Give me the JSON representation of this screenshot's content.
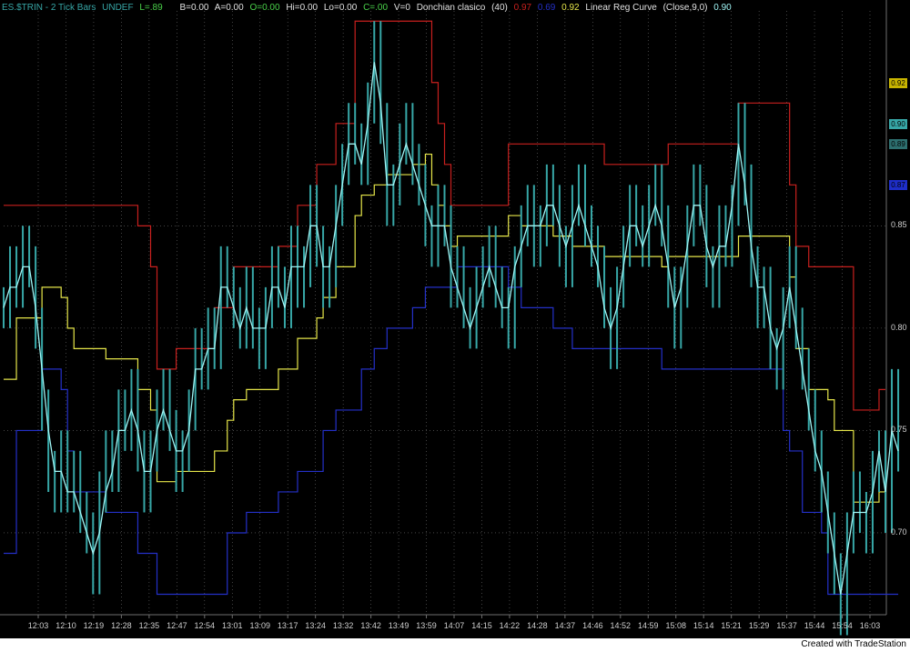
{
  "header": {
    "symbol": "ES.$TRIN - 2 Tick Bars",
    "undef": "UNDEF",
    "last": "L=.89",
    "bid": "B=0.00",
    "ask": "A=0.00",
    "open": "O=0.00",
    "high": "Hi=0.00",
    "low": "Lo=0.00",
    "close": "C=.00",
    "volume": "V=0",
    "study1_name": "Donchian clasico",
    "study1_param": "(40)",
    "study1_upper": "0.97",
    "study1_lower": "0.69",
    "study1_mid": "0.92",
    "study2_name": "Linear Reg Curve",
    "study2_param": "(Close,9,0)",
    "study2_value": "0.90"
  },
  "colors": {
    "background": "#000000",
    "donchian_upper": "#c8201e",
    "donchian_lower": "#2430c8",
    "donchian_mid": "#e6e64a",
    "price_bars": "#37a7a7",
    "lin_reg": "#9ff5f5",
    "grid": "#6e6e6e",
    "axis_text": "#cfcfcf"
  },
  "price_tags": [
    {
      "value": 0.92,
      "label": "0.92",
      "color": "#c8b400"
    },
    {
      "value": 0.9,
      "label": "0.90",
      "color": "#37a7a7"
    },
    {
      "value": 0.89,
      "label": "0.89",
      "color": "#2d6f6f"
    },
    {
      "value": 0.87,
      "label": "0.87",
      "color": "#1e2ec8"
    }
  ],
  "credit": "Created with TradeStation",
  "chart_data": {
    "type": "line",
    "ylim": [
      0.66,
      0.955
    ],
    "yticks": [
      "0.70",
      "0.75",
      "0.80",
      "0.85"
    ],
    "xtick_labels": [
      "12:03",
      "12:10",
      "12:19",
      "12:28",
      "12:35",
      "12:47",
      "12:54",
      "13:01",
      "13:09",
      "13:17",
      "13:24",
      "13:32",
      "13:42",
      "13:49",
      "13:59",
      "14:07",
      "14:15",
      "14:22",
      "14:28",
      "14:37",
      "14:46",
      "14:52",
      "14:59",
      "15:08",
      "15:14",
      "15:21",
      "15:29",
      "15:37",
      "15:44",
      "15:54",
      "16:03"
    ],
    "grid": true,
    "series": [
      {
        "name": "Donchian upper",
        "kind": "step",
        "values": [
          0.86,
          0.86,
          0.86,
          0.86,
          0.86,
          0.86,
          0.86,
          0.86,
          0.86,
          0.86,
          0.86,
          0.86,
          0.86,
          0.86,
          0.86,
          0.86,
          0.86,
          0.86,
          0.86,
          0.86,
          0.86,
          0.85,
          0.85,
          0.83,
          0.78,
          0.78,
          0.78,
          0.79,
          0.79,
          0.79,
          0.79,
          0.79,
          0.79,
          0.81,
          0.81,
          0.81,
          0.83,
          0.83,
          0.83,
          0.83,
          0.83,
          0.83,
          0.83,
          0.84,
          0.84,
          0.84,
          0.86,
          0.86,
          0.86,
          0.88,
          0.88,
          0.88,
          0.9,
          0.9,
          0.9,
          0.95,
          0.95,
          0.95,
          0.95,
          0.95,
          0.95,
          0.95,
          0.95,
          0.95,
          0.95,
          0.95,
          0.95,
          0.92,
          0.9,
          0.88,
          0.86,
          0.86,
          0.86,
          0.86,
          0.86,
          0.86,
          0.86,
          0.86,
          0.86,
          0.89,
          0.89,
          0.89,
          0.89,
          0.89,
          0.89,
          0.89,
          0.89,
          0.89,
          0.89,
          0.89,
          0.89,
          0.89,
          0.89,
          0.89,
          0.88,
          0.88,
          0.88,
          0.88,
          0.88,
          0.88,
          0.88,
          0.88,
          0.88,
          0.88,
          0.89,
          0.89,
          0.89,
          0.89,
          0.89,
          0.89,
          0.89,
          0.89,
          0.89,
          0.89,
          0.89,
          0.91,
          0.91,
          0.91,
          0.91,
          0.91,
          0.91,
          0.91,
          0.91,
          0.87,
          0.84,
          0.84,
          0.83,
          0.83,
          0.83,
          0.83,
          0.83,
          0.83,
          0.83,
          0.76,
          0.76,
          0.76,
          0.76,
          0.77,
          0.77
        ]
      },
      {
        "name": "Donchian lower",
        "kind": "step",
        "values": [
          0.69,
          0.69,
          0.75,
          0.75,
          0.75,
          0.75,
          0.78,
          0.78,
          0.78,
          0.77,
          0.74,
          0.72,
          0.72,
          0.72,
          0.72,
          0.72,
          0.71,
          0.71,
          0.71,
          0.71,
          0.71,
          0.69,
          0.69,
          0.69,
          0.67,
          0.67,
          0.67,
          0.67,
          0.67,
          0.67,
          0.67,
          0.67,
          0.67,
          0.67,
          0.67,
          0.7,
          0.7,
          0.7,
          0.71,
          0.71,
          0.71,
          0.71,
          0.71,
          0.72,
          0.72,
          0.72,
          0.73,
          0.73,
          0.73,
          0.73,
          0.75,
          0.75,
          0.76,
          0.76,
          0.76,
          0.76,
          0.78,
          0.78,
          0.79,
          0.79,
          0.8,
          0.8,
          0.8,
          0.8,
          0.81,
          0.81,
          0.82,
          0.82,
          0.82,
          0.82,
          0.82,
          0.83,
          0.83,
          0.83,
          0.83,
          0.83,
          0.83,
          0.83,
          0.83,
          0.82,
          0.82,
          0.81,
          0.81,
          0.81,
          0.81,
          0.81,
          0.8,
          0.8,
          0.8,
          0.79,
          0.79,
          0.79,
          0.79,
          0.79,
          0.79,
          0.79,
          0.79,
          0.79,
          0.79,
          0.79,
          0.79,
          0.79,
          0.79,
          0.78,
          0.78,
          0.78,
          0.78,
          0.78,
          0.78,
          0.78,
          0.78,
          0.78,
          0.78,
          0.78,
          0.78,
          0.78,
          0.78,
          0.78,
          0.78,
          0.78,
          0.78,
          0.78,
          0.75,
          0.74,
          0.74,
          0.71,
          0.71,
          0.71,
          0.7,
          0.67,
          0.67,
          0.67,
          0.67,
          0.67,
          0.67,
          0.67,
          0.67,
          0.67,
          0.67,
          0.67,
          0.67
        ]
      },
      {
        "name": "Donchian mid",
        "kind": "step",
        "values": [
          0.775,
          0.775,
          0.805,
          0.805,
          0.805,
          0.805,
          0.82,
          0.82,
          0.82,
          0.815,
          0.8,
          0.79,
          0.79,
          0.79,
          0.79,
          0.79,
          0.785,
          0.785,
          0.785,
          0.785,
          0.785,
          0.77,
          0.77,
          0.76,
          0.725,
          0.725,
          0.725,
          0.73,
          0.73,
          0.73,
          0.73,
          0.73,
          0.73,
          0.74,
          0.74,
          0.755,
          0.765,
          0.765,
          0.77,
          0.77,
          0.77,
          0.77,
          0.77,
          0.78,
          0.78,
          0.78,
          0.795,
          0.795,
          0.795,
          0.805,
          0.815,
          0.815,
          0.83,
          0.83,
          0.83,
          0.855,
          0.865,
          0.865,
          0.87,
          0.87,
          0.875,
          0.875,
          0.875,
          0.875,
          0.88,
          0.88,
          0.885,
          0.87,
          0.86,
          0.85,
          0.84,
          0.845,
          0.845,
          0.845,
          0.845,
          0.845,
          0.845,
          0.845,
          0.845,
          0.855,
          0.855,
          0.85,
          0.85,
          0.85,
          0.85,
          0.85,
          0.845,
          0.845,
          0.845,
          0.84,
          0.84,
          0.84,
          0.84,
          0.84,
          0.835,
          0.835,
          0.835,
          0.835,
          0.835,
          0.835,
          0.835,
          0.835,
          0.835,
          0.83,
          0.835,
          0.835,
          0.835,
          0.835,
          0.835,
          0.835,
          0.835,
          0.835,
          0.835,
          0.835,
          0.835,
          0.845,
          0.845,
          0.845,
          0.845,
          0.845,
          0.845,
          0.845,
          0.845,
          0.825,
          0.79,
          0.79,
          0.77,
          0.77,
          0.77,
          0.765,
          0.75,
          0.75,
          0.75,
          0.715,
          0.715,
          0.715,
          0.715,
          0.72,
          0.72
        ]
      },
      {
        "name": "Close",
        "kind": "bars",
        "values": [
          0.81,
          0.83,
          0.82,
          0.84,
          0.83,
          0.8,
          0.76,
          0.73,
          0.72,
          0.74,
          0.72,
          0.73,
          0.71,
          0.7,
          0.68,
          0.72,
          0.74,
          0.73,
          0.76,
          0.75,
          0.77,
          0.74,
          0.72,
          0.74,
          0.76,
          0.77,
          0.75,
          0.73,
          0.74,
          0.76,
          0.79,
          0.78,
          0.8,
          0.79,
          0.83,
          0.82,
          0.81,
          0.8,
          0.82,
          0.8,
          0.79,
          0.81,
          0.83,
          0.82,
          0.81,
          0.84,
          0.82,
          0.83,
          0.86,
          0.84,
          0.82,
          0.83,
          0.86,
          0.88,
          0.9,
          0.89,
          0.88,
          0.91,
          0.94,
          0.9,
          0.86,
          0.87,
          0.89,
          0.9,
          0.88,
          0.87,
          0.85,
          0.84,
          0.86,
          0.85,
          0.82,
          0.83,
          0.81,
          0.8,
          0.82,
          0.83,
          0.84,
          0.82,
          0.81,
          0.8,
          0.83,
          0.85,
          0.86,
          0.84,
          0.85,
          0.87,
          0.86,
          0.84,
          0.83,
          0.86,
          0.87,
          0.85,
          0.84,
          0.83,
          0.81,
          0.79,
          0.82,
          0.84,
          0.86,
          0.85,
          0.84,
          0.86,
          0.87,
          0.85,
          0.82,
          0.8,
          0.82,
          0.85,
          0.87,
          0.86,
          0.83,
          0.82,
          0.85,
          0.84,
          0.86,
          0.9,
          0.87,
          0.83,
          0.81,
          0.82,
          0.79,
          0.78,
          0.81,
          0.83,
          0.8,
          0.78,
          0.76,
          0.74,
          0.72,
          0.7,
          0.68,
          0.66,
          0.7,
          0.72,
          0.71,
          0.7,
          0.73,
          0.74,
          0.71,
          0.77,
          0.74
        ]
      },
      {
        "name": "Linear Reg Curve",
        "kind": "line",
        "values": [
          0.81,
          0.82,
          0.82,
          0.83,
          0.83,
          0.81,
          0.78,
          0.75,
          0.73,
          0.73,
          0.72,
          0.72,
          0.71,
          0.7,
          0.69,
          0.7,
          0.72,
          0.73,
          0.75,
          0.75,
          0.76,
          0.75,
          0.73,
          0.73,
          0.75,
          0.76,
          0.75,
          0.74,
          0.74,
          0.75,
          0.78,
          0.78,
          0.79,
          0.79,
          0.82,
          0.82,
          0.81,
          0.8,
          0.81,
          0.8,
          0.8,
          0.8,
          0.82,
          0.82,
          0.81,
          0.83,
          0.83,
          0.83,
          0.85,
          0.85,
          0.83,
          0.83,
          0.85,
          0.87,
          0.89,
          0.89,
          0.88,
          0.9,
          0.93,
          0.91,
          0.87,
          0.87,
          0.88,
          0.89,
          0.88,
          0.87,
          0.86,
          0.85,
          0.85,
          0.85,
          0.83,
          0.82,
          0.81,
          0.8,
          0.81,
          0.82,
          0.83,
          0.82,
          0.81,
          0.81,
          0.83,
          0.84,
          0.85,
          0.85,
          0.85,
          0.86,
          0.86,
          0.85,
          0.84,
          0.85,
          0.86,
          0.85,
          0.84,
          0.83,
          0.81,
          0.8,
          0.81,
          0.83,
          0.85,
          0.85,
          0.84,
          0.85,
          0.86,
          0.85,
          0.83,
          0.81,
          0.82,
          0.84,
          0.86,
          0.86,
          0.84,
          0.83,
          0.84,
          0.84,
          0.86,
          0.89,
          0.87,
          0.84,
          0.82,
          0.82,
          0.8,
          0.79,
          0.8,
          0.82,
          0.8,
          0.78,
          0.76,
          0.74,
          0.73,
          0.71,
          0.69,
          0.67,
          0.69,
          0.71,
          0.71,
          0.71,
          0.72,
          0.74,
          0.72,
          0.75,
          0.74
        ]
      }
    ]
  }
}
